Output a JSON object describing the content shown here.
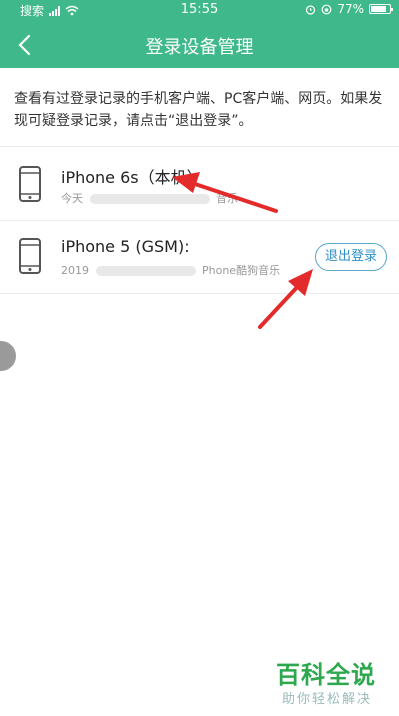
{
  "status_bar": {
    "carrier": "搜索",
    "time": "15:55",
    "battery": "77%"
  },
  "nav": {
    "title": "登录设备管理",
    "back_icon": "chevron-left-icon"
  },
  "notice": "查看有过登录记录的手机客户端、PC客户端、网页。如果发现可疑登录记录，请点击“退出登录”。",
  "devices": [
    {
      "name": "iPhone 6s（本机）",
      "info_prefix": "今天",
      "info_suffix": "音乐",
      "icon": "phone-icon"
    },
    {
      "name": "iPhone 5 (GSM):",
      "info_prefix": "2019",
      "info_suffix": "Phone酷狗音乐",
      "icon": "phone-icon",
      "action": "退出登录"
    }
  ],
  "watermark": {
    "title": "百科全说",
    "subtitle": "助你轻松解决"
  },
  "colors": {
    "header_bg": "#3fb98b",
    "logout_border": "#5aa7cf",
    "annotation_arrow": "#e32b2b"
  }
}
